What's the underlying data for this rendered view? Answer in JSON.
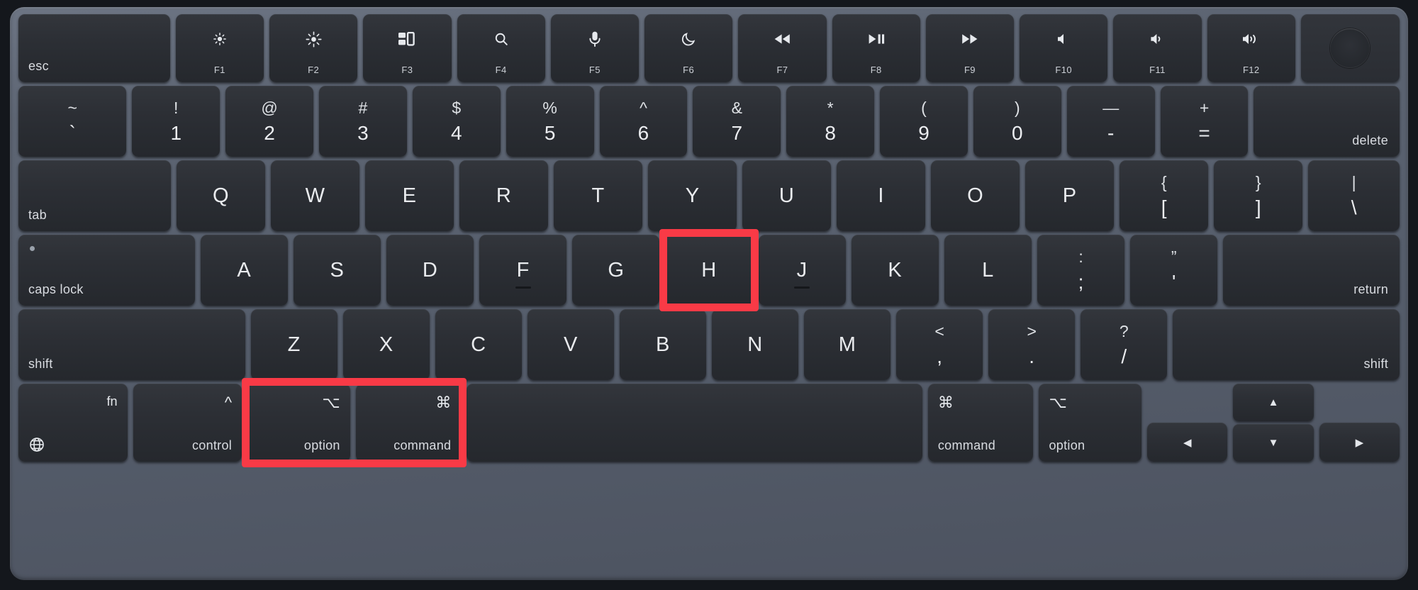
{
  "device": {
    "name": "macbook-keyboard",
    "layout": "US ANSI Magic Keyboard with Touch ID"
  },
  "colors": {
    "highlight": "#f93a46",
    "key_face": "#2c2f35",
    "deck": "#5d6573",
    "legend": "#e9ebee",
    "bezel": "#14171c"
  },
  "highlights": [
    {
      "name": "h-key-highlight",
      "target": "H"
    },
    {
      "name": "option-command-highlight",
      "target": "option + command"
    }
  ],
  "function_row": [
    {
      "label": "esc",
      "fn": "",
      "icon": ""
    },
    {
      "label": "",
      "fn": "F1",
      "icon": "brightness-down-icon"
    },
    {
      "label": "",
      "fn": "F2",
      "icon": "brightness-up-icon"
    },
    {
      "label": "",
      "fn": "F3",
      "icon": "mission-control-icon"
    },
    {
      "label": "",
      "fn": "F4",
      "icon": "search-icon"
    },
    {
      "label": "",
      "fn": "F5",
      "icon": "microphone-icon"
    },
    {
      "label": "",
      "fn": "F6",
      "icon": "do-not-disturb-moon-icon"
    },
    {
      "label": "",
      "fn": "F7",
      "icon": "rewind-icon"
    },
    {
      "label": "",
      "fn": "F8",
      "icon": "play-pause-icon"
    },
    {
      "label": "",
      "fn": "F9",
      "icon": "fast-forward-icon"
    },
    {
      "label": "",
      "fn": "F10",
      "icon": "mute-icon"
    },
    {
      "label": "",
      "fn": "F11",
      "icon": "volume-down-icon"
    },
    {
      "label": "",
      "fn": "F12",
      "icon": "volume-up-icon"
    },
    {
      "label": "",
      "fn": "",
      "icon": "touch-id-icon"
    }
  ],
  "number_row": [
    {
      "top": "~",
      "bot": "`"
    },
    {
      "top": "!",
      "bot": "1"
    },
    {
      "top": "@",
      "bot": "2"
    },
    {
      "top": "#",
      "bot": "3"
    },
    {
      "top": "$",
      "bot": "4"
    },
    {
      "top": "%",
      "bot": "5"
    },
    {
      "top": "^",
      "bot": "6"
    },
    {
      "top": "&",
      "bot": "7"
    },
    {
      "top": "*",
      "bot": "8"
    },
    {
      "top": "(",
      "bot": "9"
    },
    {
      "top": ")",
      "bot": "0"
    },
    {
      "top": "—",
      "bot": "-"
    },
    {
      "top": "+",
      "bot": "="
    }
  ],
  "number_row_end": "delete",
  "qwerty_row": {
    "tab": "tab",
    "letters": [
      "Q",
      "W",
      "E",
      "R",
      "T",
      "Y",
      "U",
      "I",
      "O",
      "P"
    ],
    "brackets": [
      {
        "top": "{",
        "bot": "["
      },
      {
        "top": "}",
        "bot": "]"
      },
      {
        "top": "|",
        "bot": "\\"
      }
    ]
  },
  "home_row": {
    "caps": "caps lock",
    "letters": [
      "A",
      "S",
      "D",
      "F",
      "G",
      "H",
      "J",
      "K",
      "L"
    ],
    "punct": [
      {
        "top": ":",
        "bot": ";"
      },
      {
        "top": "”",
        "bot": "'"
      }
    ],
    "return": "return"
  },
  "shift_row": {
    "shift_left": "shift",
    "letters": [
      "Z",
      "X",
      "C",
      "V",
      "B",
      "N",
      "M"
    ],
    "punct": [
      {
        "top": "<",
        "bot": ","
      },
      {
        "top": ">",
        "bot": "."
      },
      {
        "top": "?",
        "bot": "/"
      }
    ],
    "shift_right": "shift"
  },
  "bottom_row": {
    "fn": {
      "sym": "fn",
      "name": "",
      "icon": "globe-icon"
    },
    "control": {
      "sym": "^",
      "name": "control"
    },
    "option_left": {
      "sym": "⌥",
      "name": "option"
    },
    "command_left": {
      "sym": "⌘",
      "name": "command"
    },
    "space": "",
    "command_right": {
      "sym": "⌘",
      "name": "command"
    },
    "option_right": {
      "sym": "⌥",
      "name": "option"
    },
    "arrows": {
      "left": "◀",
      "up": "▲",
      "down": "▼",
      "right": "▶"
    }
  }
}
